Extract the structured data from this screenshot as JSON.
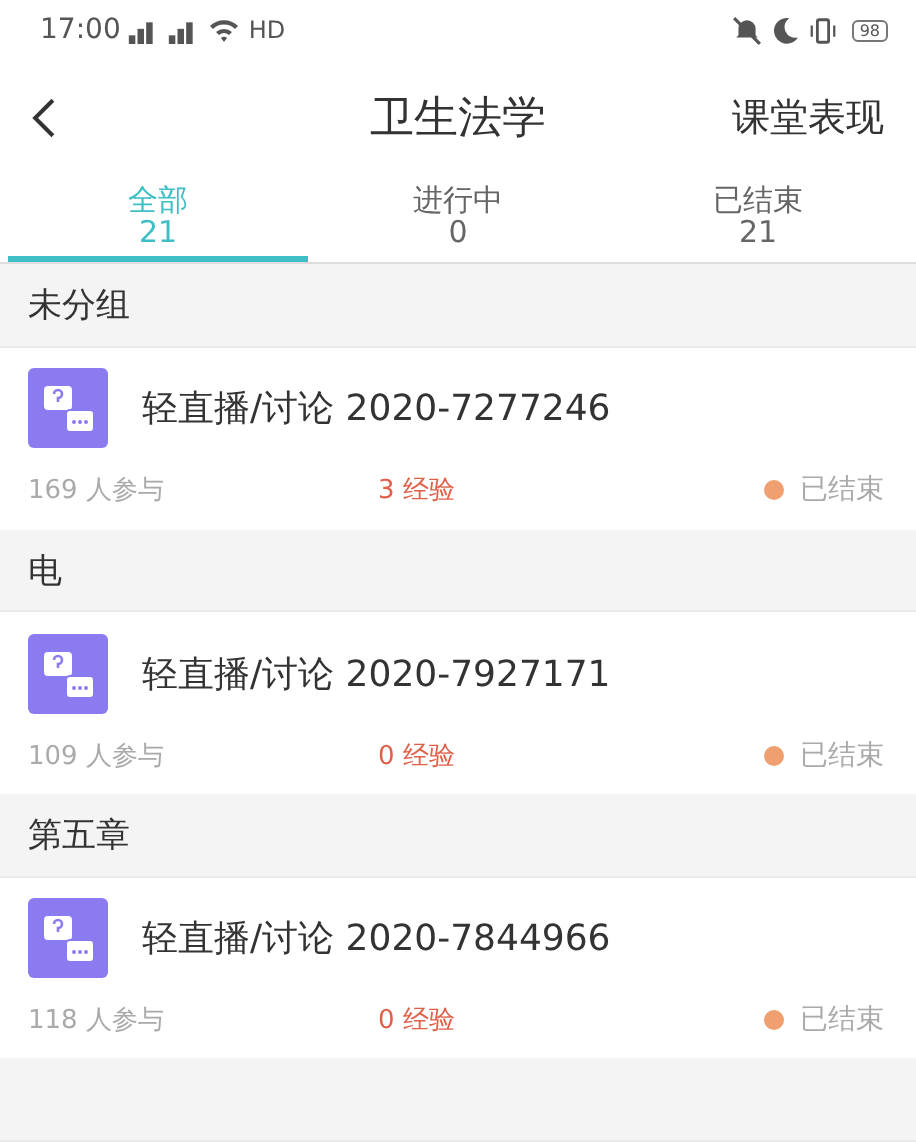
{
  "status_bar": {
    "time": "17:00",
    "network_label": "HD",
    "battery": "98"
  },
  "nav": {
    "title": "卫生法学",
    "action": "课堂表现"
  },
  "tabs": [
    {
      "label": "全部",
      "count": "21",
      "selected": true
    },
    {
      "label": "进行中",
      "count": "0",
      "selected": false
    },
    {
      "label": "已结束",
      "count": "21",
      "selected": false
    }
  ],
  "groups": [
    {
      "name": "未分组",
      "items": [
        {
          "title": "轻直播/讨论 2020-7277246",
          "participants": "169 人参与",
          "experience": "3 经验",
          "status": "已结束",
          "color": "#f0a070"
        }
      ]
    },
    {
      "name": "电",
      "items": [
        {
          "title": "轻直播/讨论 2020-7927171",
          "participants": "109 人参与",
          "experience": "0 经验",
          "status": "已结束",
          "color": "#f0a070"
        }
      ]
    },
    {
      "name": "第五章",
      "items": [
        {
          "title": "轻直播/讨论 2020-7844966",
          "participants": "118 人参与",
          "experience": "0 经验",
          "status": "已结束",
          "color": "#f0a070"
        }
      ]
    }
  ]
}
